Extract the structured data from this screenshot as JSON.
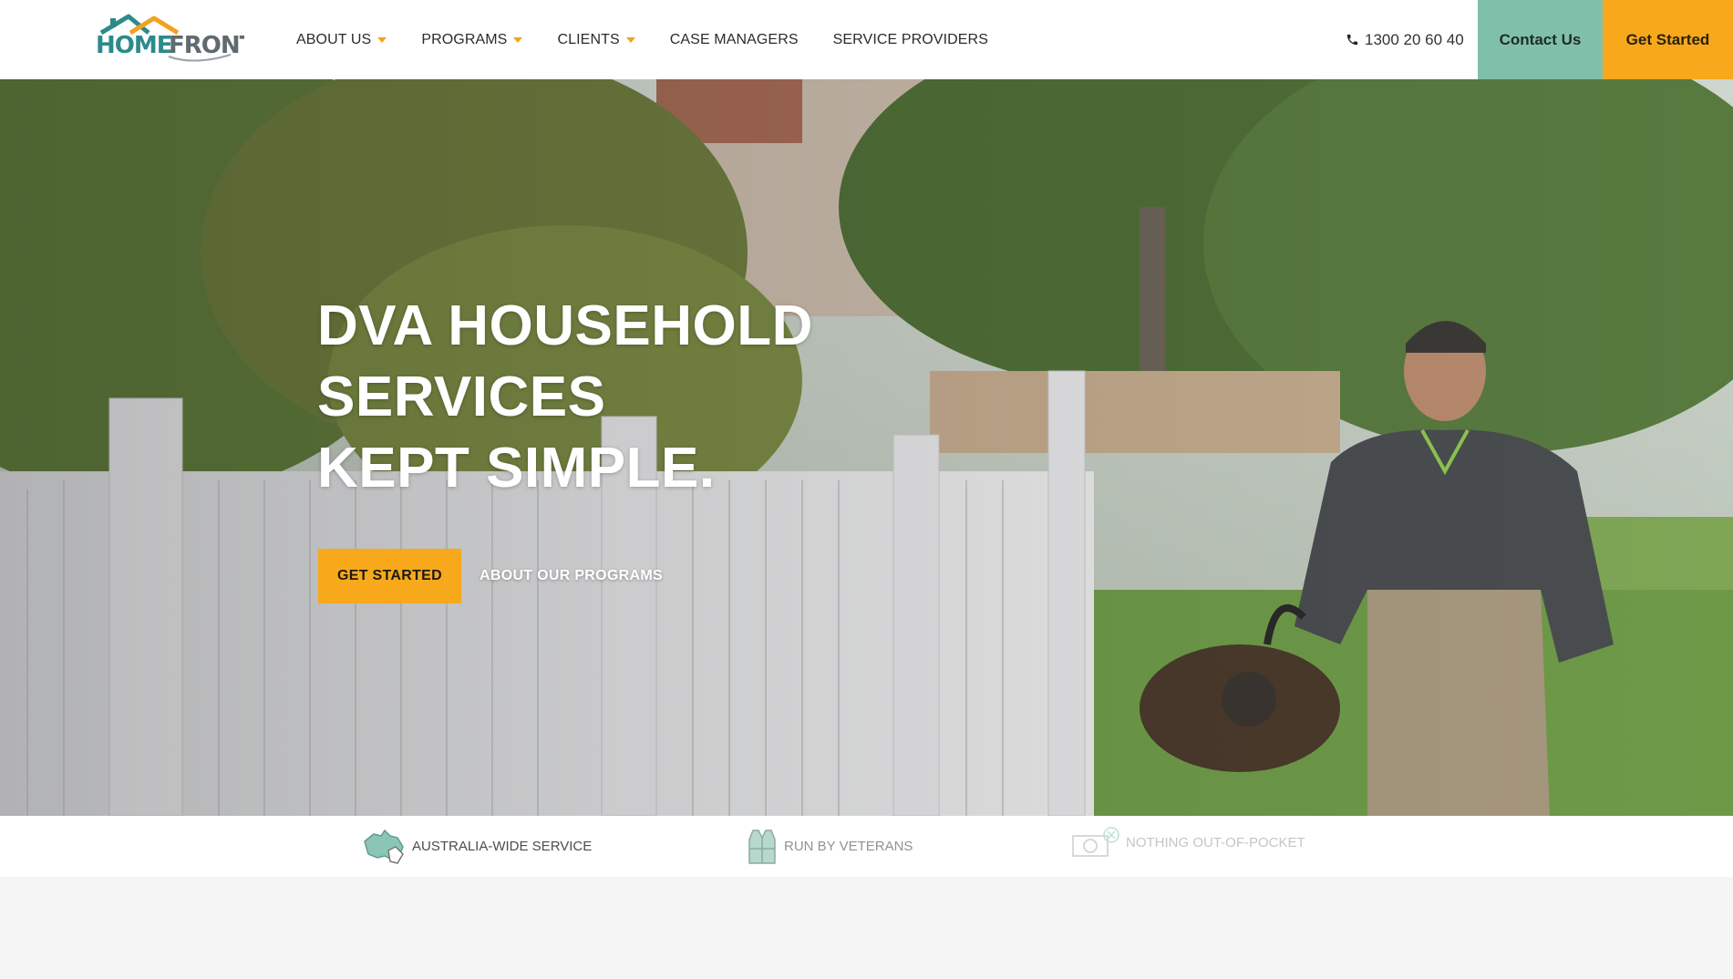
{
  "header": {
    "logo_text": "HOMEFRONT",
    "nav": [
      {
        "label": "ABOUT US",
        "dropdown": true
      },
      {
        "label": "PROGRAMS",
        "dropdown": true
      },
      {
        "label": "CLIENTS",
        "dropdown": true
      },
      {
        "label": "CASE MANAGERS",
        "dropdown": false
      },
      {
        "label": "SERVICE PROVIDERS",
        "dropdown": false
      }
    ],
    "phone": "1300 20 60 40",
    "contact_label": "Contact Us",
    "get_started_label": "Get Started"
  },
  "hero": {
    "title_lines": [
      "DVA HOUSEHOLD",
      "SERVICES",
      "KEPT SIMPLE."
    ],
    "cta_label": "GET STARTED",
    "link_label": "ABOUT OUR PROGRAMS"
  },
  "features": [
    {
      "label": "AUSTRALIA-WIDE SERVICE",
      "icon": "australia-map-icon"
    },
    {
      "label": "RUN BY VETERANS",
      "icon": "vest-icon"
    },
    {
      "label": "NOTHING OUT-OF-POCKET",
      "icon": "money-icon"
    }
  ],
  "colors": {
    "accent_orange": "#f7a81b",
    "accent_teal": "#80c0aa",
    "logo_teal": "#2d8a8a",
    "logo_orange": "#f3a21f"
  }
}
